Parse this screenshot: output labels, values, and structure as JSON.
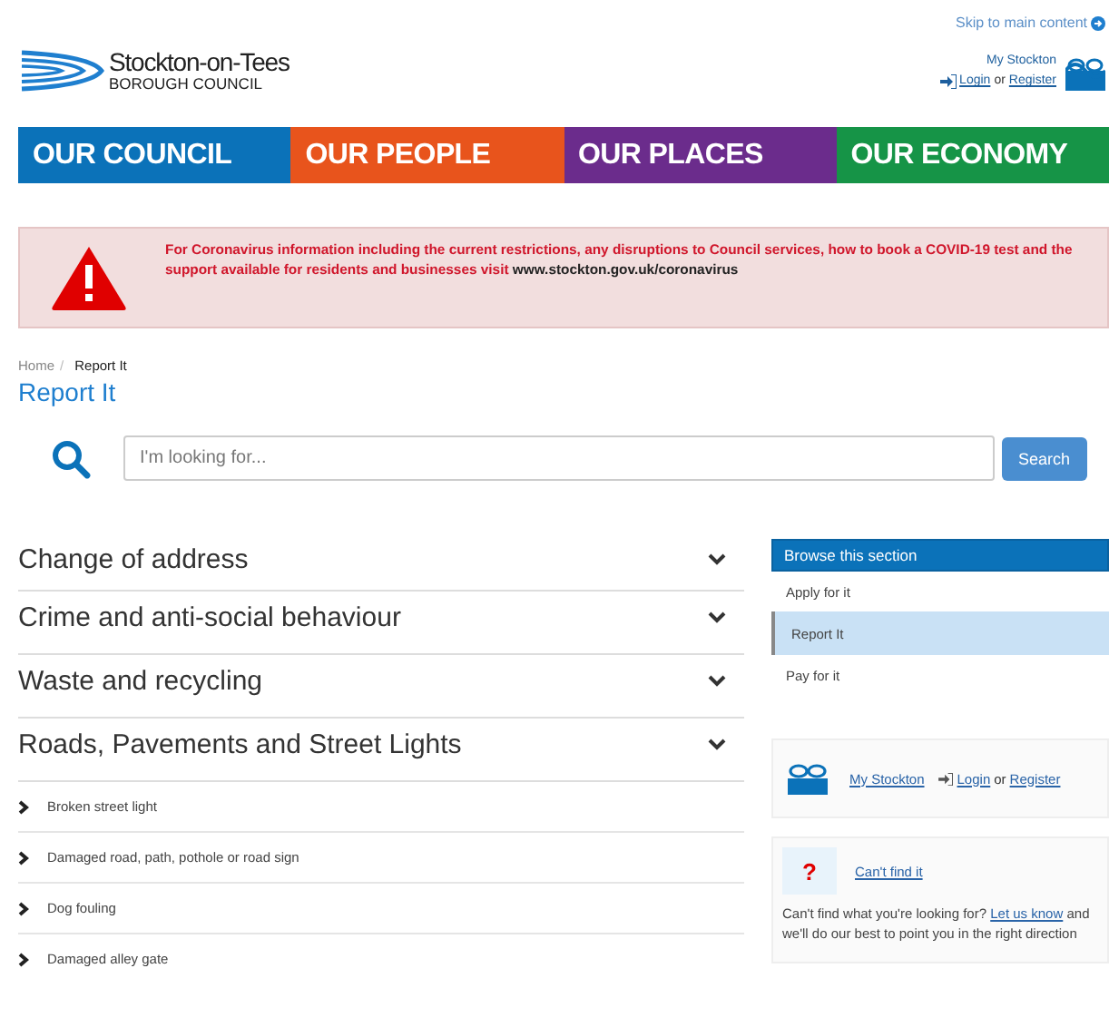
{
  "header": {
    "skip_link": "Skip to main content",
    "logo_name": "Stockton-on-Tees",
    "logo_sub": "BOROUGH COUNCIL",
    "my_stockton": "My Stockton",
    "login": "Login",
    "or": "or",
    "register": "Register"
  },
  "nav": [
    {
      "label": "OUR COUNCIL",
      "color": "#0b72b9"
    },
    {
      "label": "OUR PEOPLE",
      "color": "#e8541c"
    },
    {
      "label": "OUR PLACES",
      "color": "#6b2c8c"
    },
    {
      "label": "OUR ECONOMY",
      "color": "#169447"
    }
  ],
  "alert": {
    "text": "For Coronavirus information including the current restrictions, any disruptions to Council services, how to book a COVID-19 test and the support available for residents and businesses visit **www.stockton.gov.uk/coronavirus**"
  },
  "breadcrumb": [
    {
      "label": "Home",
      "selected": false
    },
    {
      "label": "Report It",
      "selected": true
    }
  ],
  "breadcrumb_separator": "/",
  "page_title": "Report It",
  "search": {
    "placeholder": "I'm looking for...",
    "button": "Search"
  },
  "sections": [
    {
      "title": "Change of address"
    },
    {
      "title": "Crime and anti-social behaviour"
    },
    {
      "title": "Waste and recycling"
    },
    {
      "title": "Roads, Pavements and Street Lights",
      "children": [
        "Broken street light",
        "Damaged road, path, pothole or road sign",
        "Dog fouling",
        "Damaged alley gate"
      ]
    }
  ],
  "browse": {
    "title": "Browse this section",
    "items": [
      {
        "label": "Apply for it",
        "selected": false
      },
      {
        "label": "Report It",
        "selected": true
      },
      {
        "label": "Pay for it",
        "selected": false
      }
    ]
  },
  "my_stockton_panel": {
    "link": "My Stockton",
    "login": "Login",
    "or": "or",
    "register": "Register"
  },
  "cant_find": {
    "icon": "?",
    "title": "Can't find it",
    "text_before": "Can't find what you're looking for?",
    "link": "Let us know",
    "text_after": "and we'll do our best to point you in the right direction"
  }
}
